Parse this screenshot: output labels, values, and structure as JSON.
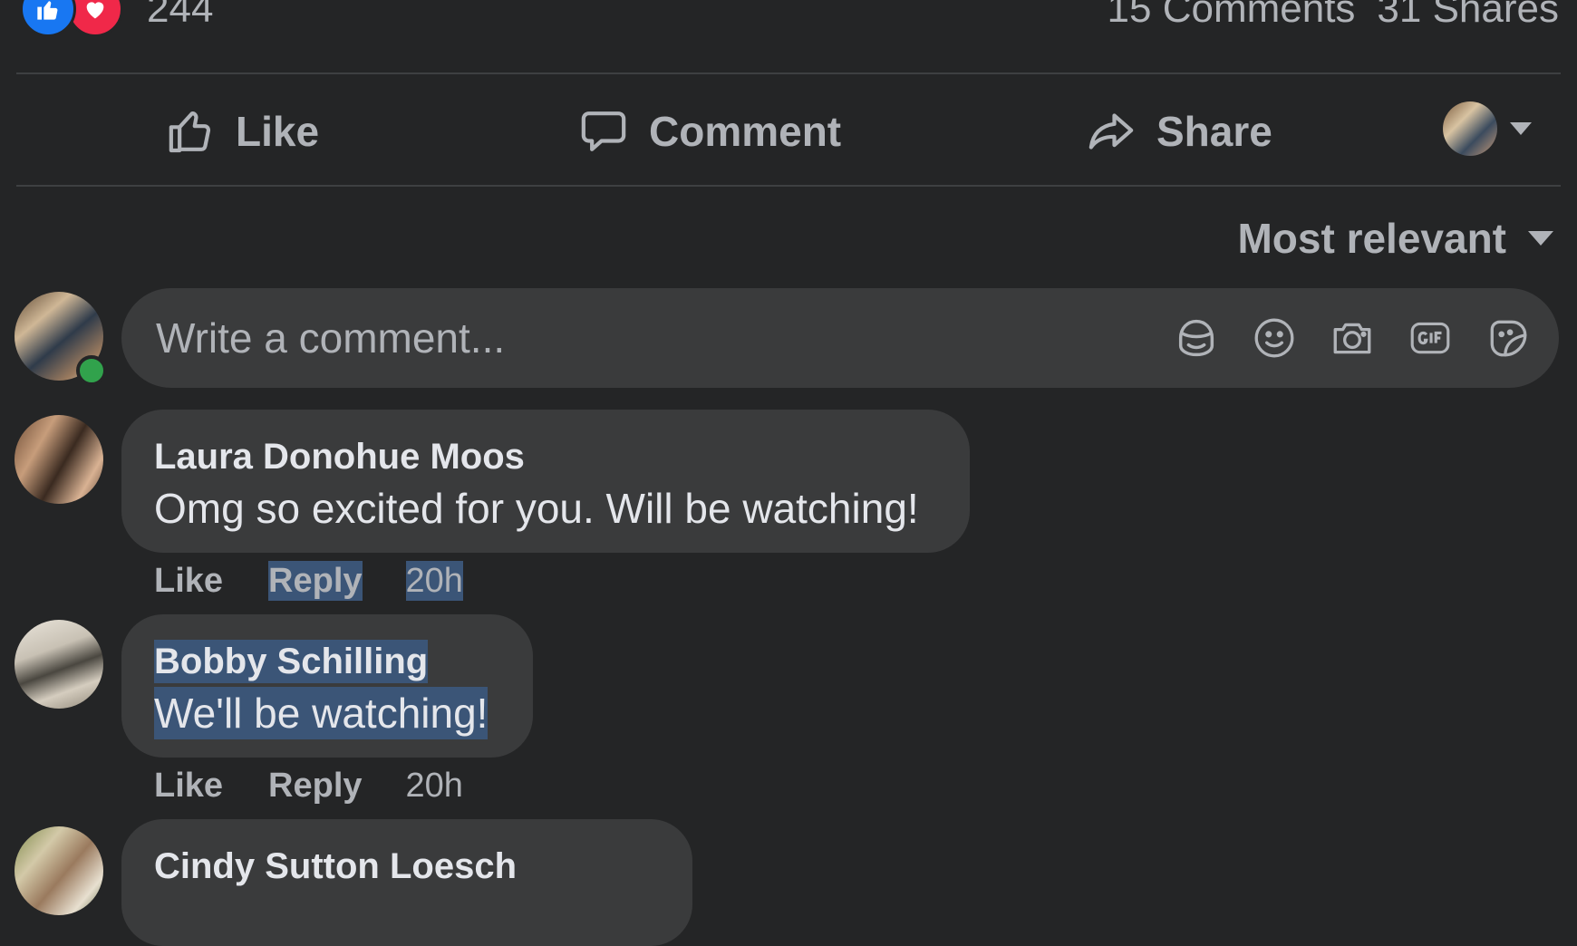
{
  "post_stats": {
    "reaction_count": "244",
    "comments": "15 Comments",
    "shares": "31 Shares",
    "reaction_icons": [
      "thumbs-up-icon",
      "heart-icon"
    ]
  },
  "actions": {
    "like": "Like",
    "comment": "Comment",
    "share": "Share"
  },
  "sort": {
    "label": "Most relevant"
  },
  "composer": {
    "placeholder": "Write a comment...",
    "icons": [
      "avatar-sticker-icon",
      "emoji-icon",
      "camera-icon",
      "gif-icon",
      "sticker-icon"
    ]
  },
  "comments": [
    {
      "author": "Laura Donohue Moos",
      "text": "Omg so excited for you. Will be watching!",
      "like": "Like",
      "reply": "Reply",
      "time": "20h"
    },
    {
      "author": "Bobby Schilling",
      "text": "We'll be watching!",
      "like": "Like",
      "reply": "Reply",
      "time": "20h"
    },
    {
      "author": "Cindy Sutton Loesch",
      "text": ""
    }
  ],
  "colors": {
    "background": "#242526",
    "bubble": "#3a3b3c",
    "primary_text": "#e4e6eb",
    "secondary_text": "#b0b3b8",
    "like_blue": "#1877f2",
    "love_red": "#f02849",
    "online_green": "#31a24c",
    "selection": "#3b5577"
  }
}
